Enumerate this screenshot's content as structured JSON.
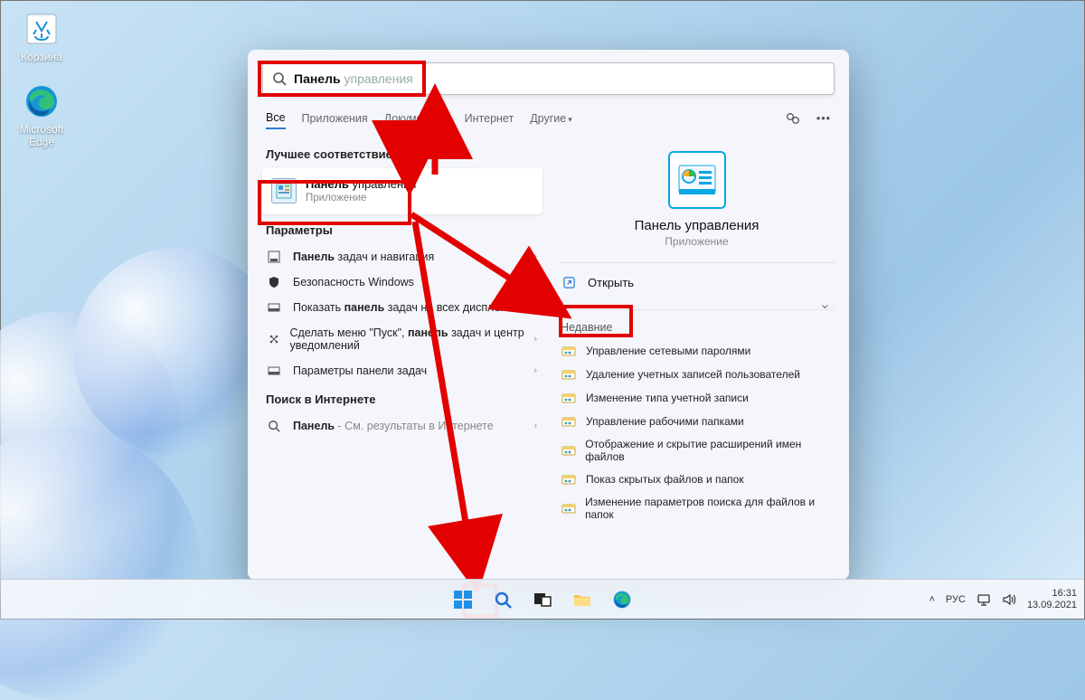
{
  "desktop": {
    "recycle_bin": "Корзина",
    "edge": "Microsoft Edge"
  },
  "search": {
    "query_bold": "Панель",
    "query_rest": " управления",
    "tabs": [
      "Все",
      "Приложения",
      "Документы",
      "Интернет",
      "Другие"
    ],
    "best_match_header": "Лучшее соответствие",
    "best": {
      "title_bold": "Панель",
      "title_rest": " управления",
      "subtitle": "Приложение"
    },
    "params_header": "Параметры",
    "params": [
      "<b>Панель</b> задач и навигация",
      "Безопасность Windows",
      "Показать <b>панель</b> задач на всех дисплеях",
      "Сделать меню \"Пуск\", <b>панель</b> задач и центр уведомлений",
      "Параметры панели задач"
    ],
    "web_header": "Поиск в Интернете",
    "web_item_bold": "Панель",
    "web_item_rest": " - См. результаты в Интернете"
  },
  "detail": {
    "title": "Панель управления",
    "subtitle": "Приложение",
    "open": "Открыть",
    "recent_header": "Недавние",
    "recent": [
      "Управление сетевыми паролями",
      "Удаление учетных записей пользователей",
      "Изменение типа учетной записи",
      "Управление рабочими папками",
      "Отображение и скрытие расширений имен файлов",
      "Показ скрытых файлов и папок",
      "Изменение параметров поиска для файлов и папок"
    ]
  },
  "tray": {
    "lang": "РУС",
    "time": "16:31",
    "date": "13.09.2021"
  }
}
